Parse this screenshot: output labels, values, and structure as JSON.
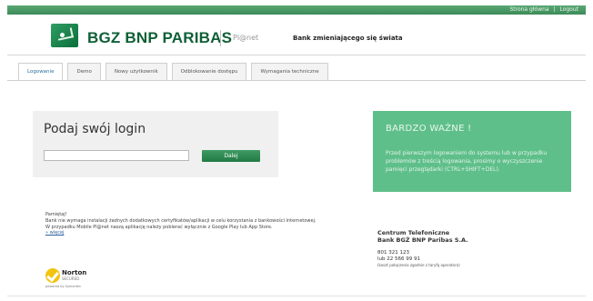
{
  "header": {
    "top_links": [
      "Strona główna",
      "|",
      "Logout"
    ],
    "brand": "BGZ BNP PARIBAS",
    "product": "Pl@net",
    "slogan": "Bank zmieniającego się świata"
  },
  "tabs": [
    {
      "label": "Logowanie",
      "active": true
    },
    {
      "label": "Demo",
      "active": false
    },
    {
      "label": "Nowy użytkownik",
      "active": false
    },
    {
      "label": "Odblokowanie dostępu",
      "active": false
    },
    {
      "label": "Wymagania techniczne",
      "active": false
    }
  ],
  "login": {
    "title": "Podaj swój login",
    "input_value": "",
    "button_label": "Dalej"
  },
  "info": {
    "title": "BARDZO WAŻNE !",
    "text": "Przed pierwszym logowaniem do systemu lub w przypadku problemów z treścią logowania, prosimy o wyczyszczenie pamięci przeglądarki (CTRL+SHIFT+DEL)."
  },
  "notice": {
    "heading": "Pamiętaj!",
    "line1": "Bank nie wymaga instalacji żadnych dodatkowych certyfikatów/aplikacji w celu korzystania z bankowości internetowej.",
    "line2": "W przypadku Mobile Pl@net naszą aplikację należy pobierać wyłącznie z Google Play lub App Store.",
    "more": "» więcej"
  },
  "norton": {
    "label": "Norton",
    "sub": "SECURED",
    "powered": "powered by Symantec"
  },
  "contact": {
    "title": "Centrum Telefoniczne",
    "bank": "Bank BGŻ BNP Paribas S.A.",
    "phone1": "801 321 123",
    "phone2": "lub 22 566 99 91",
    "note": "(koszt połączenia zgodnie z taryfą operatora)"
  },
  "colors": {
    "brand_green": "#0e5f36",
    "accent_green": "#5fbf8a",
    "tab_active_text": "#2a6e9a"
  }
}
